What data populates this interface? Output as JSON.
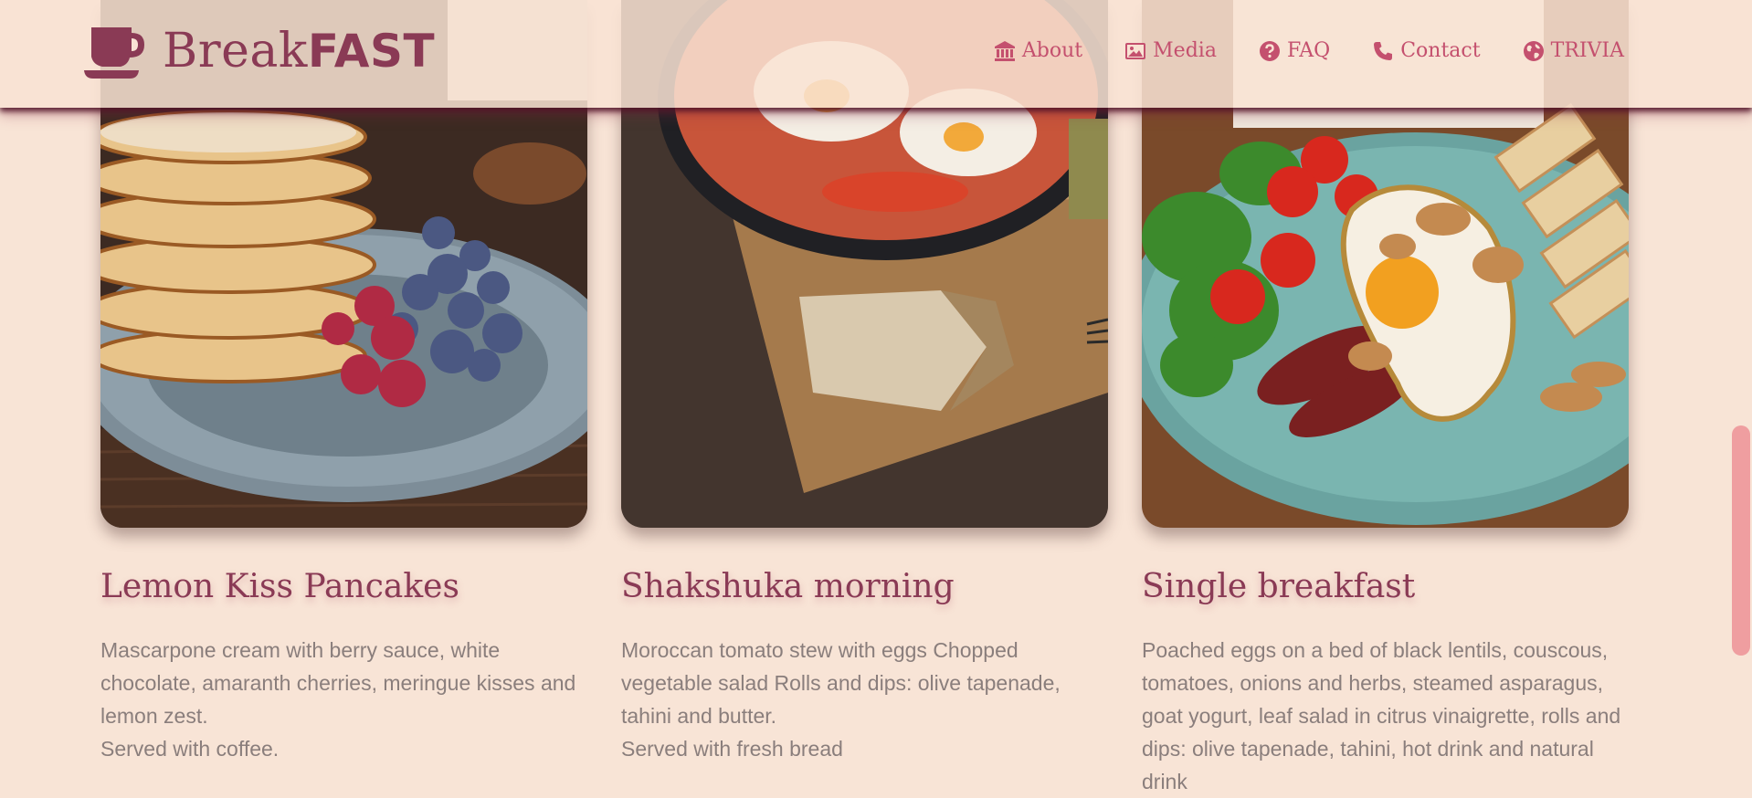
{
  "brand": {
    "name_light": "Break",
    "name_bold": "FAST",
    "logo_icon": "coffee-cup-icon"
  },
  "nav": [
    {
      "label": "About",
      "icon": "building-columns-icon"
    },
    {
      "label": "Media",
      "icon": "image-icon"
    },
    {
      "label": "FAQ",
      "icon": "question-circle-icon"
    },
    {
      "label": "Contact",
      "icon": "phone-icon"
    },
    {
      "label": "TRIVIA",
      "icon": "globe-icon"
    }
  ],
  "cards": [
    {
      "title": "Lemon Kiss Pancakes",
      "image": "pancakes-with-berries-photo",
      "description": "Mascarpone cream with berry sauce, white chocolate, amaranth cherries, meringue kisses and lemon zest.",
      "extra": "Served with coffee."
    },
    {
      "title": "Shakshuka morning",
      "image": "shakshuka-pan-and-bread-photo",
      "description": "Moroccan tomato stew with eggs Chopped vegetable salad Rolls and dips: olive tapenade, tahini and butter.",
      "extra": "Served with fresh bread"
    },
    {
      "title": "Single breakfast",
      "image": "fried-egg-bacon-salad-photo",
      "description": "Poached eggs on a bed of black lentils, couscous, tomatoes, onions and herbs, steamed asparagus, goat yogurt, leaf salad in citrus vinaigrette, rolls and dips: olive tapenade, tahini, hot drink and natural drink"
    }
  ],
  "colors": {
    "accent": "#c4506e",
    "brand": "#8a3a55",
    "background": "#f8e4d6",
    "scrollbar": "#ef9ea0"
  }
}
